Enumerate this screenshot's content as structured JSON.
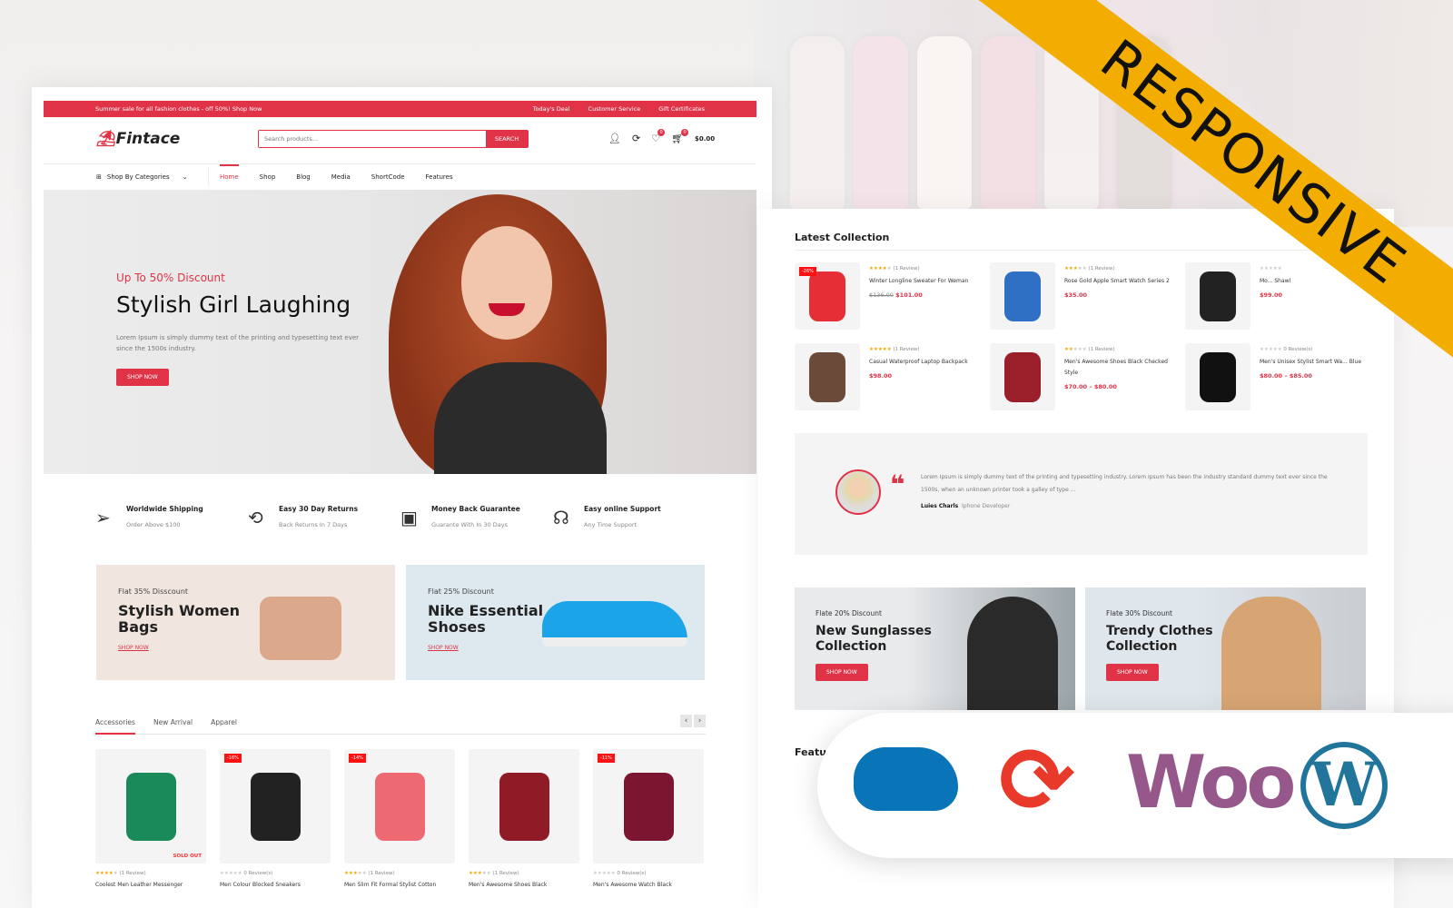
{
  "topbar": {
    "promo": "Summer sale for all fashion clothes - off 50%! Shop Now",
    "links": [
      "Today's Deal",
      "Customer Service",
      "Gift Certificates"
    ]
  },
  "header": {
    "logo": "Fintace",
    "search_placeholder": "Search products...",
    "search_button": "SEARCH",
    "wishlist_count": "0",
    "cart_count": "0",
    "cart_total": "$0.00"
  },
  "nav": {
    "categories": "Shop By Categories",
    "items": [
      "Home",
      "Shop",
      "Blog",
      "Media",
      "ShortCode",
      "Features"
    ],
    "active": "Home"
  },
  "hero": {
    "subtitle": "Up To 50% Discount",
    "title": "Stylish Girl Laughing",
    "text": "Lorem Ipsum is simply dummy text of the printing and typesetting text ever since the 1500s industry.",
    "button": "SHOP NOW"
  },
  "features": [
    {
      "icon": "paper-plane-icon",
      "title": "Worldwide Shipping",
      "sub": "Order Above $100"
    },
    {
      "icon": "returns-icon",
      "title": "Easy 30 Day Returns",
      "sub": "Back Returns In 7 Days"
    },
    {
      "icon": "wallet-icon",
      "title": "Money Back Guarantee",
      "sub": "Guarante With In 30 Days"
    },
    {
      "icon": "headset-icon",
      "title": "Easy online Support",
      "sub": "Any Time Support"
    }
  ],
  "promos": [
    {
      "sub": "Flat 35% Disscount",
      "title": "Stylish Women Bags",
      "link": "SHOP NOW",
      "bg": "#f1e6df"
    },
    {
      "sub": "Flat 25% Discount",
      "title": "Nike Essential Shoses",
      "link": "SHOP NOW",
      "bg": "#dde8ef"
    }
  ],
  "product_tabs": {
    "tabs": [
      "Accessories",
      "New Arrival",
      "Apparel"
    ],
    "active": "Accessories"
  },
  "products": [
    {
      "name": "Coolest Men Leather Messenger",
      "rating": 4,
      "reviews": "(1 Review)",
      "badge": "",
      "status": "SOLD OUT",
      "color": "#1a8a5a"
    },
    {
      "name": "Men Colour Blocked Sneakers",
      "rating": 0,
      "reviews": "0 Review(s)",
      "badge": "-16%",
      "status": "",
      "color": "#222"
    },
    {
      "name": "Men Slim Fit Formal Stylist Cotton",
      "rating": 3,
      "reviews": "(1 Review)",
      "badge": "-14%",
      "status": "",
      "color": "#ee6a72"
    },
    {
      "name": "Men's Awesome Shoes Black",
      "rating": 3,
      "reviews": "(1 Review)",
      "badge": "",
      "status": "",
      "color": "#8e1b25"
    },
    {
      "name": "Men's Awesome Watch Black",
      "rating": 0,
      "reviews": "0 Review(s)",
      "badge": "-11%",
      "status": "",
      "color": "#7b1530"
    }
  ],
  "latest": {
    "title": "Latest Collection",
    "items": [
      {
        "name": "Winter Longline Sweater For Weman",
        "rating": 4,
        "reviews": "(1 Review)",
        "old_price": "$136.00",
        "price": "$101.00",
        "badge": "-26%",
        "color": "#e52e35"
      },
      {
        "name": "Rose Gold Apple Smart Watch Series 2",
        "rating": 3,
        "reviews": "(1 Review)",
        "old_price": "",
        "price": "$35.00",
        "badge": "",
        "color": "#2f6fc4"
      },
      {
        "name": "Mo... Shawl",
        "rating": 0,
        "reviews": "",
        "old_price": "",
        "price": "$99.00",
        "badge": "",
        "color": "#222"
      },
      {
        "name": "Casual Waterproof Laptop Backpack",
        "rating": 5,
        "reviews": "(1 Review)",
        "old_price": "",
        "price": "$98.00",
        "badge": "",
        "color": "#6b4a3a"
      },
      {
        "name": "Men's Awesome Shoes Black Checked Style",
        "rating": 2,
        "reviews": "(1 Review)",
        "old_price": "",
        "price": "$70.00 – $80.00",
        "badge": "",
        "color": "#9a1f2a"
      },
      {
        "name": "Men's Unisex Stylist Smart Wa... Blue",
        "rating": 0,
        "reviews": "0 Review(s)",
        "old_price": "",
        "price": "$80.00 – $85.00",
        "badge": "",
        "color": "#111"
      }
    ]
  },
  "testimonial": {
    "text": "Lorem Ipsum is simply dummy text of the printing and typesetting industry. Lorem Ipsum has been the industry standard dummy text ever since the 1500s, when an unknown printer took a galley of type ...",
    "author": "Luies Charls",
    "role": "Iphone Developer"
  },
  "right_promos": [
    {
      "sub": "Flate 20% Discount",
      "title": "New Sunglasses Collection",
      "button": "SHOP NOW",
      "bg": "#e4e7ea"
    },
    {
      "sub": "Flate 30% Discount",
      "title": "Trendy Clothes Collection",
      "button": "SHOP NOW",
      "bg": "#dfe6ec"
    }
  ],
  "featured_title": "Featu",
  "ribbon": "RESPONSIVE",
  "badges": {
    "icons": [
      "chef-hat-icon",
      "sync-icon",
      "woocommerce-logo",
      "wordpress-logo"
    ],
    "woo": "Woo"
  },
  "colors": {
    "accent": "#e03347",
    "ribbon": "#f2ad00",
    "woo": "#96588a",
    "wp": "#21759b"
  }
}
